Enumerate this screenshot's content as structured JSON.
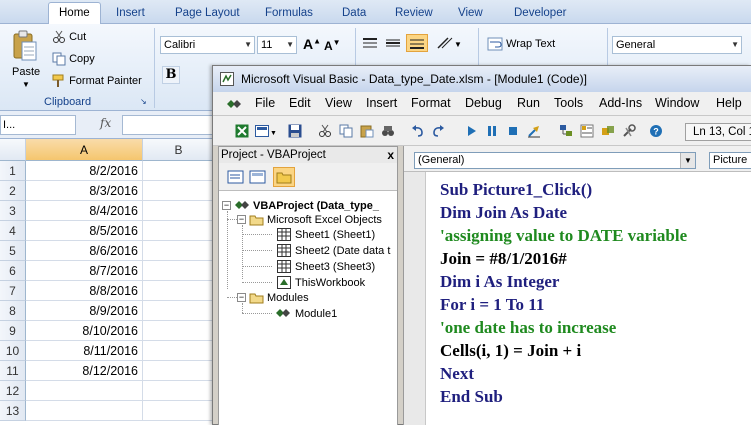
{
  "excel": {
    "tabs": [
      "Home",
      "Insert",
      "Page Layout",
      "Formulas",
      "Data",
      "Review",
      "View",
      "Developer"
    ],
    "active_tab": "Home",
    "ribbon": {
      "paste_label": "Paste",
      "cut_label": "Cut",
      "copy_label": "Copy",
      "format_painter_label": "Format Painter",
      "clipboard_group_label": "Clipboard",
      "font_name": "Calibri",
      "font_size": "11",
      "wrap_text_label": "Wrap Text",
      "number_format": "General",
      "bold_label": "B"
    },
    "formula_bar": {
      "name_box": "I...",
      "fx_label": "fx"
    },
    "columns": [
      "A",
      "B"
    ],
    "rows": [
      {
        "num": "1",
        "a": "8/2/2016"
      },
      {
        "num": "2",
        "a": "8/3/2016"
      },
      {
        "num": "3",
        "a": "8/4/2016"
      },
      {
        "num": "4",
        "a": "8/5/2016"
      },
      {
        "num": "5",
        "a": "8/6/2016"
      },
      {
        "num": "6",
        "a": "8/7/2016"
      },
      {
        "num": "7",
        "a": "8/8/2016"
      },
      {
        "num": "8",
        "a": "8/9/2016"
      },
      {
        "num": "9",
        "a": "8/10/2016"
      },
      {
        "num": "10",
        "a": "8/11/2016"
      },
      {
        "num": "11",
        "a": "8/12/2016"
      },
      {
        "num": "12",
        "a": ""
      },
      {
        "num": "13",
        "a": ""
      }
    ]
  },
  "vbe": {
    "title": "Microsoft Visual Basic - Data_type_Date.xlsm - [Module1 (Code)]",
    "menu": [
      "File",
      "Edit",
      "View",
      "Insert",
      "Format",
      "Debug",
      "Run",
      "Tools",
      "Add-Ins",
      "Window",
      "Help"
    ],
    "position_status": "Ln 13, Col 1",
    "project": {
      "title": "Project - VBAProject",
      "close": "x",
      "root": "VBAProject (Data_type_",
      "excel_objects_folder": "Microsoft Excel Objects",
      "sheets": [
        "Sheet1 (Sheet1)",
        "Sheet2 (Date data t",
        "Sheet3 (Sheet3)",
        "ThisWorkbook"
      ],
      "modules_folder": "Modules",
      "module": "Module1"
    },
    "code": {
      "object_dropdown": "(General)",
      "proc_dropdown": "Picture",
      "lines": [
        {
          "text": "Sub Picture1_Click()",
          "kind": "kw"
        },
        {
          "text": "Dim Join As Date",
          "kind": "kw"
        },
        {
          "text": "'assigning value to DATE variable",
          "kind": "cm"
        },
        {
          "text": "Join = #8/1/2016#",
          "kind": "tx"
        },
        {
          "text": "Dim i As Integer",
          "kind": "kw"
        },
        {
          "text": "For i = 1 To 11",
          "kind": "kw"
        },
        {
          "text": "'one date has to increase",
          "kind": "cm"
        },
        {
          "text": "Cells(i, 1) = Join + i",
          "kind": "tx"
        },
        {
          "text": "Next",
          "kind": "kw"
        },
        {
          "text": "End Sub",
          "kind": "kw"
        }
      ]
    }
  }
}
